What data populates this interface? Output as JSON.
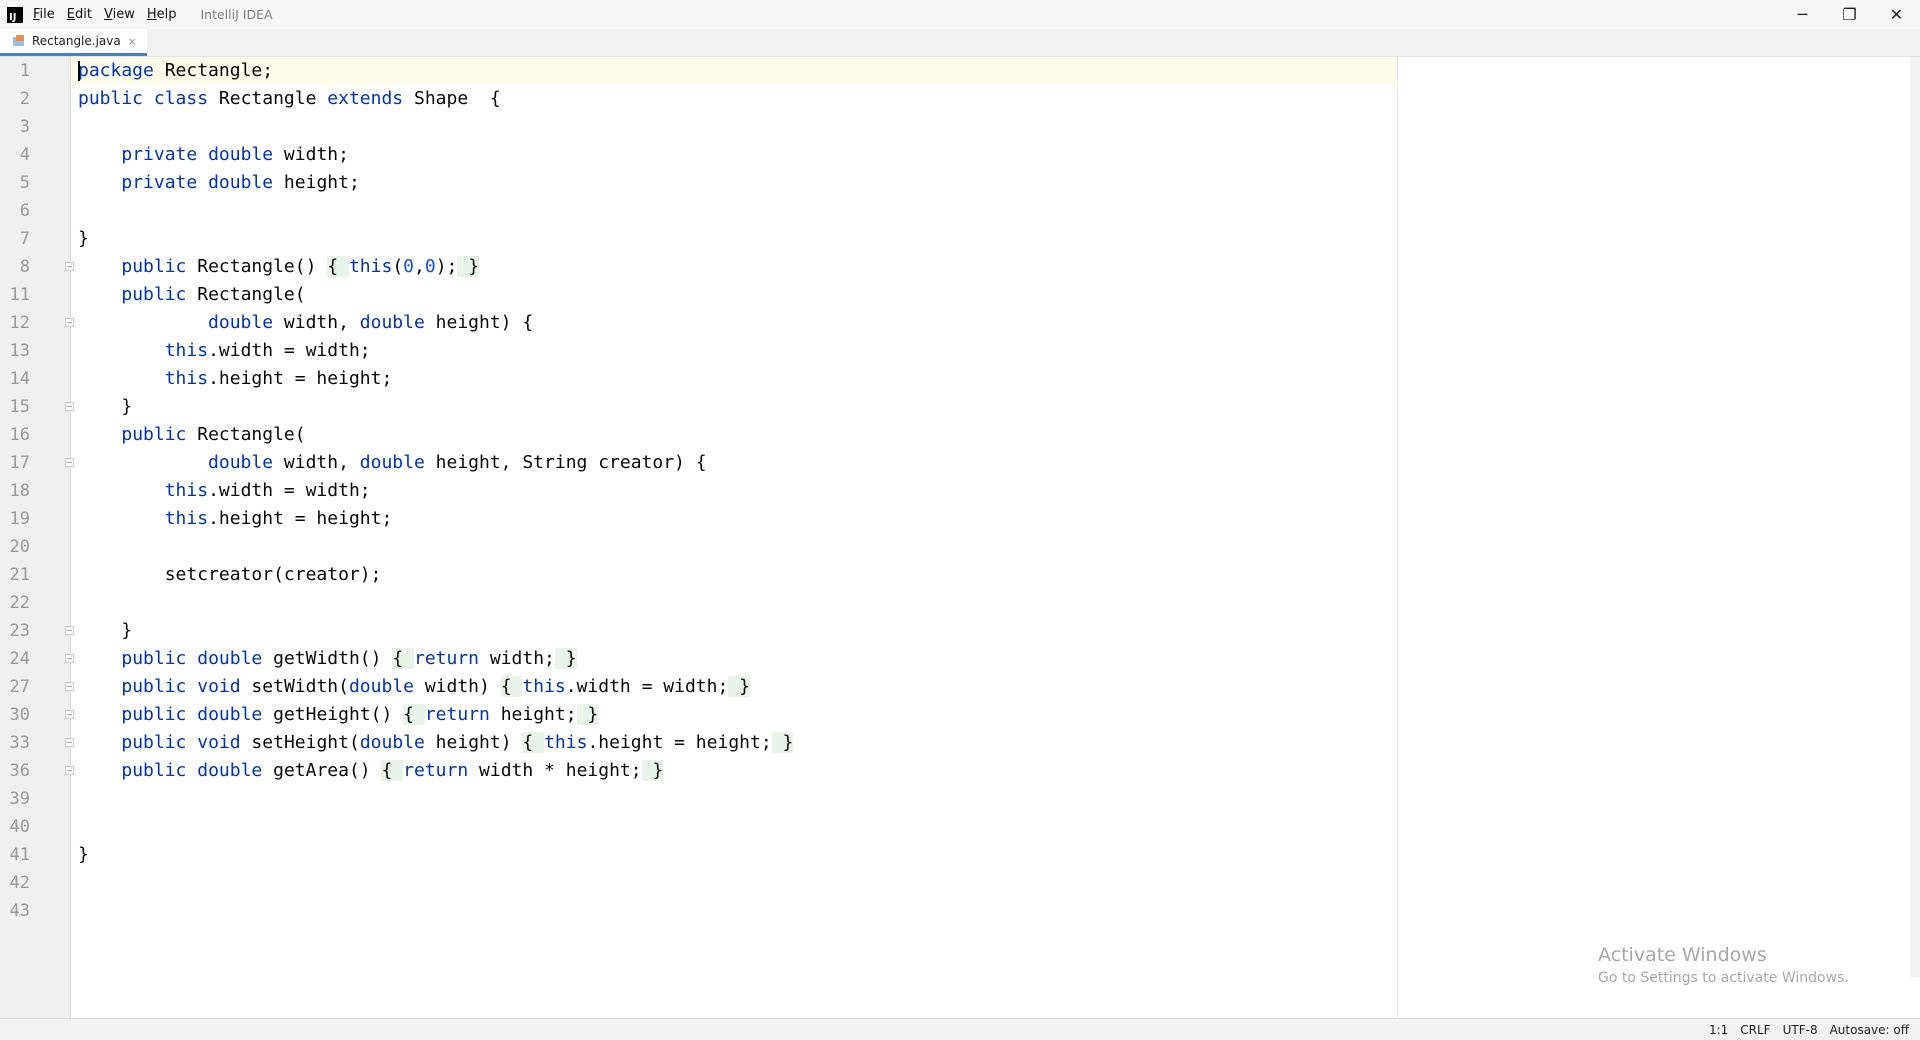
{
  "window": {
    "menu": [
      {
        "mnemonic": "F",
        "rest": "ile"
      },
      {
        "mnemonic": "E",
        "rest": "dit"
      },
      {
        "mnemonic": "V",
        "rest": "iew"
      },
      {
        "mnemonic": "H",
        "rest": "elp"
      }
    ],
    "app_name": "IntelliJ IDEA",
    "controls": {
      "minimize": "─",
      "restore": "❐",
      "close": "✕"
    }
  },
  "tabs": [
    {
      "label": "Rectangle.java",
      "close": "×",
      "icon": "java-class-icon",
      "active": true
    }
  ],
  "editor": {
    "line_numbers": [
      "1",
      "2",
      "3",
      "4",
      "5",
      "6",
      "7",
      "8",
      "11",
      "12",
      "13",
      "14",
      "15",
      "16",
      "17",
      "18",
      "19",
      "20",
      "21",
      "22",
      "23",
      "24",
      "27",
      "30",
      "33",
      "36",
      "39",
      "40",
      "41",
      "42",
      "43"
    ],
    "lines": {
      "l1": {
        "kw": "package",
        "rest": " Rectangle;"
      },
      "l2": {
        "kw1": "public",
        "kw2": "class",
        "name": " Rectangle ",
        "kw3": "extends",
        "rest": " Shape  {"
      },
      "l4": {
        "indent": "    ",
        "kw1": "private",
        "kw2": "double",
        "rest": " width;"
      },
      "l5": {
        "indent": "    ",
        "kw1": "private",
        "kw2": "double",
        "rest": " height;"
      },
      "l7": {
        "text": "}"
      },
      "l8": {
        "indent": "    ",
        "kw1": "public",
        "name": " Rectangle() ",
        "ob": "{ ",
        "kw2": "this",
        "p1": "(",
        "n1": "0",
        "c": ",",
        "n2": "0",
        "p2": ");",
        "cb": " }"
      },
      "l11": {
        "indent": "    ",
        "kw1": "public",
        "rest": " Rectangle("
      },
      "l12": {
        "indent": "            ",
        "kw1": "double",
        "mid": " width, ",
        "kw2": "double",
        "rest": " height) {"
      },
      "l13": {
        "indent": "        ",
        "kw": "this",
        "rest": ".width = width;"
      },
      "l14": {
        "indent": "        ",
        "kw": "this",
        "rest": ".height = height;"
      },
      "l15": {
        "text": "    }"
      },
      "l16": {
        "indent": "    ",
        "kw1": "public",
        "rest": " Rectangle("
      },
      "l17": {
        "indent": "            ",
        "kw1": "double",
        "mid": " width, ",
        "kw2": "double",
        "rest": " height, String creator) {"
      },
      "l18": {
        "indent": "        ",
        "kw": "this",
        "rest": ".width = width;"
      },
      "l19": {
        "indent": "        ",
        "kw": "this",
        "rest": ".height = height;"
      },
      "l21": {
        "text": "        setcreator(creator);"
      },
      "l23": {
        "text": "    }"
      },
      "l24": {
        "indent": "    ",
        "kw1": "public",
        "kw2": "double",
        "name": " getWidth() ",
        "ob": "{ ",
        "kw3": "return",
        "body": " width;",
        "cb": " }"
      },
      "l27": {
        "indent": "    ",
        "kw1": "public",
        "kw2": "void",
        "name": " setWidth(",
        "kw3": "double",
        "args": " width) ",
        "ob": "{ ",
        "kw4": "this",
        "body": ".width = width;",
        "cb": " }"
      },
      "l30": {
        "indent": "    ",
        "kw1": "public",
        "kw2": "double",
        "name": " getHeight() ",
        "ob": "{ ",
        "kw3": "return",
        "body": " height;",
        "cb": " }"
      },
      "l33": {
        "indent": "    ",
        "kw1": "public",
        "kw2": "void",
        "name": " setHeight(",
        "kw3": "double",
        "args": " height) ",
        "ob": "{ ",
        "kw4": "this",
        "body": ".height = height;",
        "cb": " }"
      },
      "l36": {
        "indent": "    ",
        "kw1": "public",
        "kw2": "double",
        "name": " getArea() ",
        "ob": "{ ",
        "kw3": "return",
        "body": " width * height;",
        "cb": " }"
      },
      "l41": {
        "text": "}"
      }
    }
  },
  "watermark": {
    "title": "Activate Windows",
    "subtitle": "Go to Settings to activate Windows."
  },
  "status": {
    "position": "1:1",
    "line_ending": "CRLF",
    "encoding": "UTF-8",
    "autosave": "Autosave: off"
  },
  "colors": {
    "keyword": "#0033b3",
    "number": "#1750eb",
    "current_line": "#fdfbe9",
    "folded_block": "#e8f4e8"
  }
}
